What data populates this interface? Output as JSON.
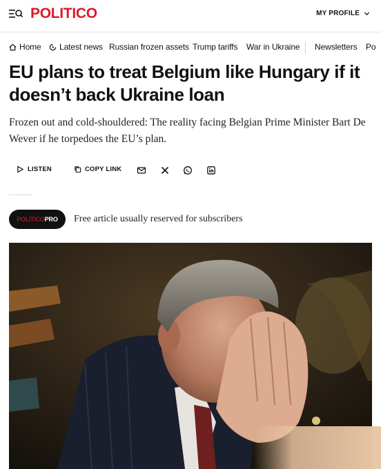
{
  "header": {
    "logo": "POLITICO",
    "profile_label": "MY PROFILE"
  },
  "nav": {
    "items": [
      {
        "label": "Home",
        "icon": "home-icon"
      },
      {
        "label": "Latest news",
        "icon": "clock-icon"
      },
      {
        "label": "Russian frozen assets"
      },
      {
        "label": "Trump tariffs"
      },
      {
        "label": "War in Ukraine"
      },
      {
        "label": "Newsletters"
      },
      {
        "label": "Po"
      }
    ]
  },
  "article": {
    "headline": "EU plans to treat Belgium like Hungary if it doesn’t back Ukraine loan",
    "dek": "Frozen out and cold-shouldered: The reality facing Belgian Prime Minister Bart De Wever if he torpedoes the EU’s plan."
  },
  "share": {
    "listen_label": "LISTEN",
    "copy_label": "COPY LINK",
    "icons": [
      "mail-icon",
      "x-icon",
      "whatsapp-icon",
      "linkedin-icon"
    ]
  },
  "pro": {
    "badge_part1": "POLITICO",
    "badge_part2": "PRO",
    "note": "Free article usually reserved for subscribers"
  },
  "colors": {
    "brand_red": "#dc1a28",
    "badge_bg": "#111111"
  }
}
